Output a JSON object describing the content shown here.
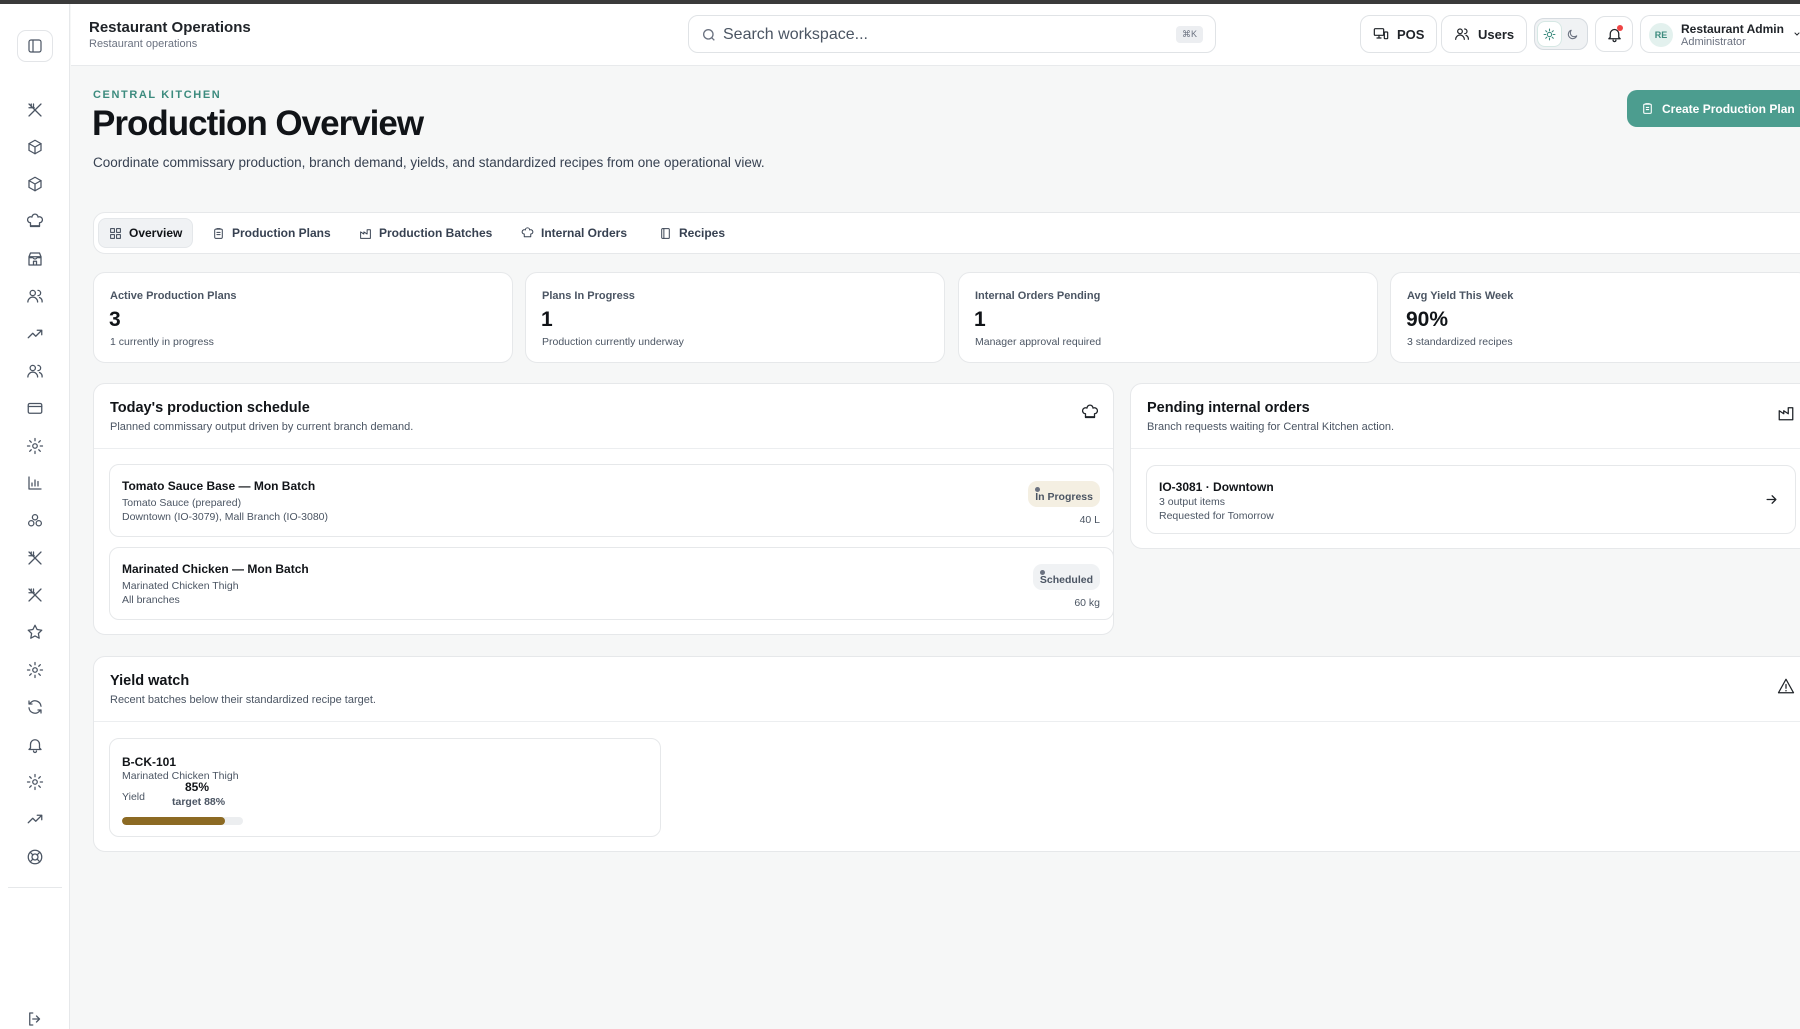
{
  "app": {
    "title": "Restaurant Operations",
    "subtitle": "Restaurant operations"
  },
  "search": {
    "placeholder": "Search workspace...",
    "shortcut": "⌘K"
  },
  "topbar": {
    "pos_label": "POS",
    "users_label": "Users"
  },
  "user": {
    "initials": "RE",
    "name": "Restaurant Admin",
    "role": "Administrator"
  },
  "sidebar": {
    "icons": [
      "sidebar-toggle-icon",
      "utensils-icon",
      "package-icon",
      "package-icon",
      "chef-hat-icon",
      "store-icon",
      "users-icon",
      "trending-up-icon",
      "users-icon",
      "credit-card-icon",
      "settings-icon",
      "bar-chart-icon",
      "boxes-icon",
      "utensils-icon",
      "utensils-icon",
      "star-icon",
      "settings-icon",
      "refresh-icon",
      "bell-icon",
      "settings-icon",
      "trending-up-icon",
      "help-icon",
      "logout-icon"
    ]
  },
  "header": {
    "eyebrow": "CENTRAL KITCHEN",
    "title": "Production Overview",
    "description": "Coordinate commissary production, branch demand, yields, and standardized recipes from one operational view.",
    "create_label": "Create Production Plan"
  },
  "tabs": [
    {
      "label": "Overview",
      "active": true
    },
    {
      "label": "Production Plans"
    },
    {
      "label": "Production Batches"
    },
    {
      "label": "Internal Orders"
    },
    {
      "label": "Recipes"
    }
  ],
  "stats": [
    {
      "label": "Active Production Plans",
      "value": "3",
      "sub": "1 currently in progress"
    },
    {
      "label": "Plans In Progress",
      "value": "1",
      "sub": "Production currently underway"
    },
    {
      "label": "Internal Orders Pending",
      "value": "1",
      "sub": "Manager approval required"
    },
    {
      "label": "Avg Yield This Week",
      "value": "90%",
      "sub": "3 standardized recipes"
    }
  ],
  "schedule": {
    "title": "Today's production schedule",
    "subtitle": "Planned commissary output driven by current branch demand.",
    "items": [
      {
        "title": "Tomato Sauce Base — Mon Batch",
        "recipe": "Tomato Sauce (prepared)",
        "branches": "Downtown (IO-3079), Mall Branch (IO-3080)",
        "status": "In Progress",
        "qty": "40 L"
      },
      {
        "title": "Marinated Chicken — Mon Batch",
        "recipe": "Marinated Chicken Thigh",
        "branches": "All branches",
        "status": "Scheduled",
        "qty": "60 kg"
      }
    ]
  },
  "orders": {
    "title": "Pending internal orders",
    "subtitle": "Branch requests waiting for Central Kitchen action.",
    "items": [
      {
        "title": "IO-3081 · Downtown",
        "items": "3 output items",
        "requested": "Requested for Tomorrow"
      }
    ]
  },
  "yield": {
    "title": "Yield watch",
    "subtitle": "Recent batches below their standardized recipe target.",
    "items": [
      {
        "batch": "B-CK-101",
        "recipe": "Marinated Chicken Thigh",
        "label": "Yield",
        "value": "85%",
        "target": "target 88%",
        "fill": 0.85
      }
    ]
  },
  "colors": {
    "accent": "#4c9d8f",
    "eyebrow": "#3c8b7e",
    "yield_bar": "#8c6a23",
    "notification": "#ef4444"
  }
}
